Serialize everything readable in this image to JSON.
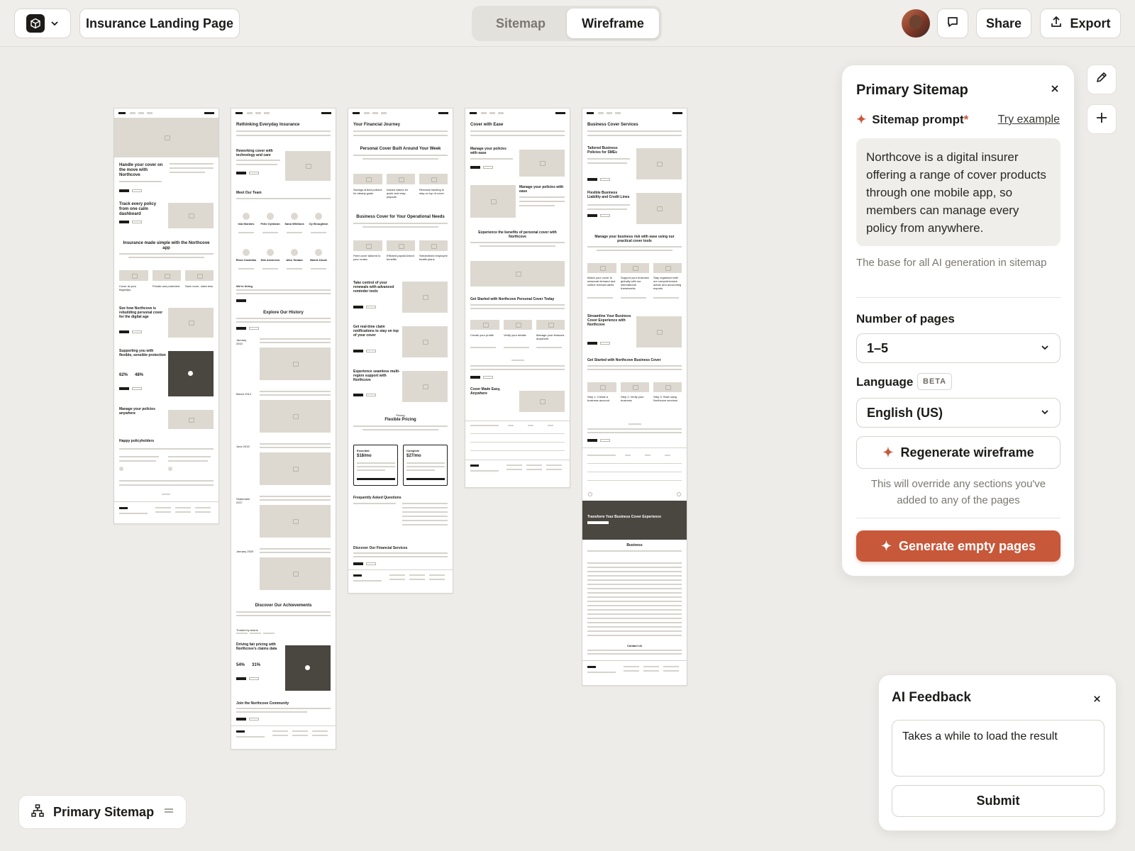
{
  "header": {
    "project_title": "Insurance Landing Page",
    "tabs": [
      {
        "label": "Sitemap",
        "active": false
      },
      {
        "label": "Wireframe",
        "active": true
      }
    ],
    "share_label": "Share",
    "export_label": "Export"
  },
  "canvas": {
    "pages": [
      {
        "texts": [
          "Handle your cover on the move with Northcove",
          "Track every policy from one calm dashboard",
          "Insurance made simple with the Northcove app",
          "Cover at your fingertips",
          "Private and protected",
          "Save more, claim less",
          "See how Northcove is rebuilding personal cover for the digital age",
          "Supporting you with flexible, sensible protection",
          "62%",
          "48%",
          "Manage your policies anywhere",
          "Happy policyholders"
        ]
      },
      {
        "texts": [
          "Rethinking Everyday Insurance",
          "Reworking cover with technology and care",
          "Meet Our Team",
          "Isla Morales",
          "Felix Oyelaran",
          "Sana Whitlock",
          "Oy Broughton",
          "Rhea Castellan",
          "Nils Andersen",
          "Aiko Tanaka",
          "Marek Duval",
          "We're hiring",
          "Explore Our History",
          "January 2010",
          "March 2012",
          "June 2015",
          "September 2017",
          "January 2020",
          "Discover Our Achievements",
          "Trusted by teams",
          "Driving fair pricing with Northcove's claims data",
          "54%",
          "31%",
          "Join the Northcove Community"
        ]
      },
      {
        "texts": [
          "Your Financial Journey",
          "Personal Cover Built Around Your Week",
          "Savings-linked policies for steady goals",
          "Instant claims for quick and easy payouts",
          "Renewal tracking to stay on top of cover",
          "Business Cover for Your Operational Needs",
          "Fleet cover tailored to your routes",
          "Efficient payroll-linked benefits",
          "Streamlined employee health plans",
          "Take control of your renewals with advanced reminder tools",
          "Get real-time claim notifications to stay on top of your cover",
          "Experience seamless multi-region support with Northcove",
          "Pricing",
          "Flexible Pricing",
          "Essential",
          "$18/mo",
          "Complete",
          "$27/mo",
          "Frequently Asked Questions",
          "Discover Our Financial Services"
        ]
      },
      {
        "texts": [
          "Cover with Ease",
          "Manage your policies with ease",
          "Manage your policies with ease",
          "Experience the benefits of personal cover with Northcove",
          "Get Started with Northcove Personal Cover Today",
          "Create your profile",
          "Verify your details",
          "Manage your finances anywhere",
          "Cover Made Easy, Anywhere"
        ]
      },
      {
        "texts": [
          "Business Cover Services",
          "Tailored Business Policies for SMEs",
          "Flexible Business Liability and Credit Lines",
          "Manage your business risk with ease using our practical cover tools",
          "Match your cover to seasonal demand and collect renewal alerts",
          "Support your business globally with our international frameworks",
          "Stay organised with our comprehensive admin and accounting exports",
          "Streamline Your Business Cover Experience with Northcove",
          "Get Started with Northcove Business Cover",
          "Step 1: Create a business account",
          "Step 2: Verify your business",
          "Step 3: Start using Northcove services",
          "Transform Your Business Cover Experience",
          "Business",
          "Contact Us"
        ]
      }
    ]
  },
  "panel": {
    "title": "Primary Sitemap",
    "prompt_label": "Sitemap prompt",
    "required_mark": "*",
    "try_example": "Try example",
    "prompt_text": "Northcove is a digital insurer offering a range of cover products through one mobile app, so members can manage every policy from anywhere.",
    "helper": "The base for all AI generation in sitemap",
    "pages_label": "Number of pages",
    "pages_value": "1–5",
    "language_label": "Language",
    "beta": "BETA",
    "language_value": "English (US)",
    "regenerate": "Regenerate wireframe",
    "regen_warning": "This will override any sections you've added to any of the pages",
    "generate": "Generate empty pages"
  },
  "feedback": {
    "title": "AI Feedback",
    "value": "Takes a while to load the result",
    "submit": "Submit"
  },
  "bottom": {
    "label": "Primary Sitemap"
  },
  "colors": {
    "accent": "#c8583a",
    "canvas": "#edece9",
    "placeholder": "#ddd9d0",
    "dark_block": "#4a4640"
  }
}
